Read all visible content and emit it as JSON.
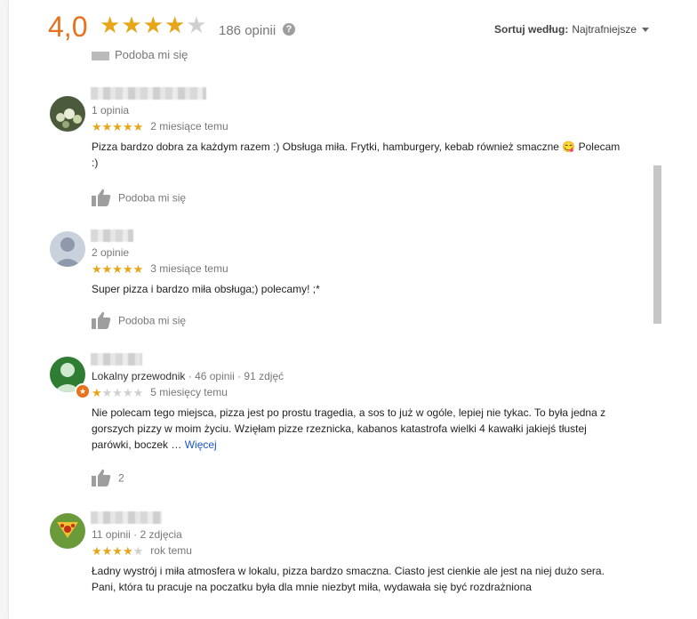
{
  "header": {
    "rating": "4,0",
    "stars_filled": 4,
    "review_count": "186 opinii",
    "help_glyph": "?",
    "sort_label": "Sortuj według:",
    "sort_value": "Najtrafniejsze"
  },
  "partial_like_label": "Podoba mi się",
  "reviews": [
    {
      "meta": "1 opinia",
      "stars": 5,
      "date": "2 miesiące temu",
      "text": "Pizza bardzo dobra za każdym razem :) Obsługa miła. Frytki, hamburgery, kebab również smaczne 😋 Polecam :)",
      "like_label": "Podoba mi się"
    },
    {
      "meta": "2 opinie",
      "stars": 5,
      "date": "3 miesiące temu",
      "text": "Super pizza i bardzo miła obsługa;) polecamy! ;*",
      "like_label": "Podoba mi się"
    },
    {
      "meta_guide": "Lokalny przewodnik",
      "meta_rest": " · 46 opinii · 91 zdjęć",
      "stars": 1,
      "date": "5 miesięcy temu",
      "text": "Nie polecam tego miejsca, pizza jest po prostu tragedia, a sos to już w ogóle, lepiej nie tykac. To była jedna z gorszych pizzy w moim życiu. Wzięłam pizze rzeznicka, kabanos katastrofa wielki 4 kawałki jakiejś tłustej parówki, boczek …",
      "more_label": "Więcej",
      "like_count": "2"
    },
    {
      "meta": "11 opinii · 2 zdjęcia",
      "stars": 4,
      "date": "rok temu",
      "text": "Ładny wystrój i miła atmosfera w lokalu, pizza bardzo smaczna. Ciasto jest cienkie ale jest na niej dużo sera. Pani, która tu pracuje na poczatku była dla mnie niezbyt miła, wydawała się być rozdrażniona"
    }
  ],
  "colors": {
    "rating": "#e7711b",
    "star": "#e7a518",
    "star_empty": "#d0d0d0",
    "link": "#1a55c4"
  }
}
